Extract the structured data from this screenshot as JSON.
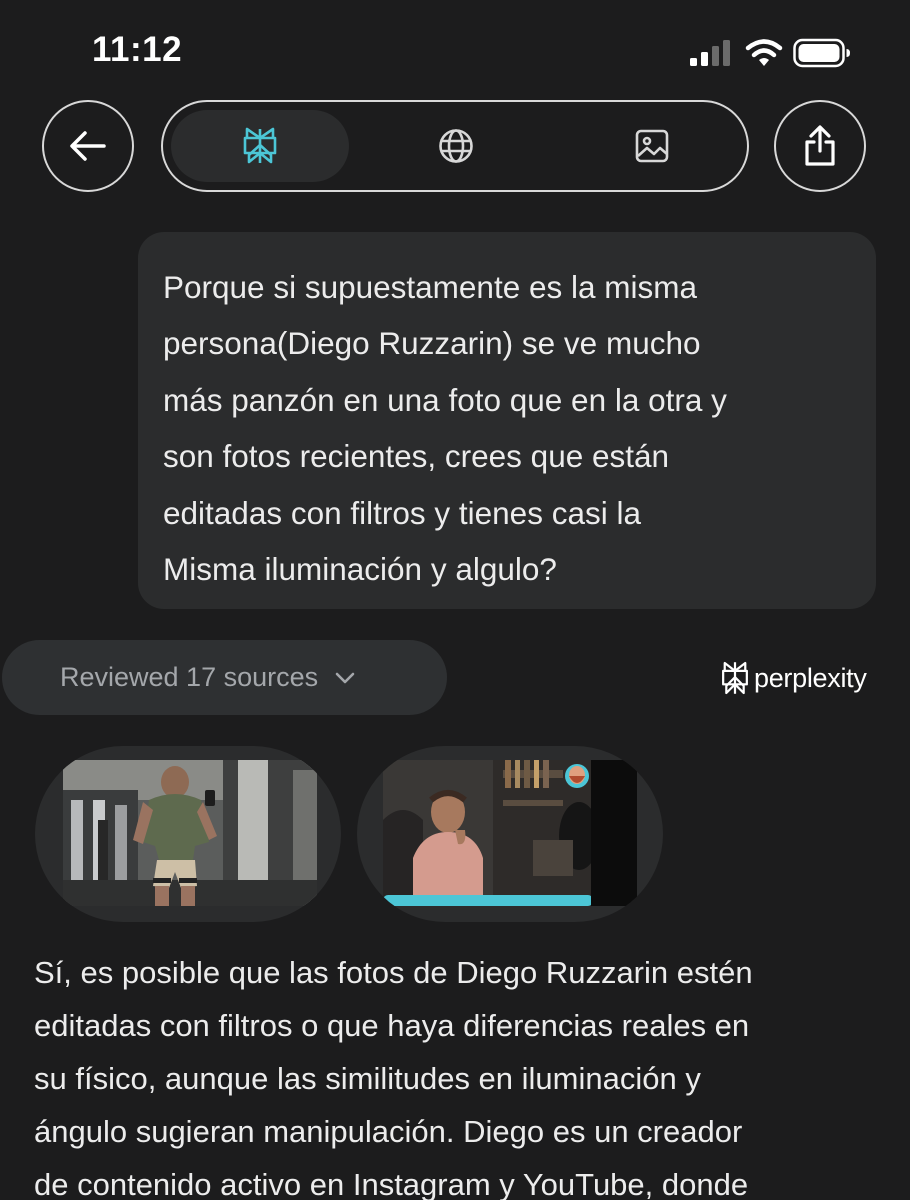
{
  "status_bar": {
    "time": "11:12"
  },
  "toolbar": {
    "back_icon": "arrow-left-icon",
    "share_icon": "share-icon",
    "tabs": [
      {
        "icon": "perplexity-logo-icon",
        "active": true
      },
      {
        "icon": "globe-icon",
        "active": false
      },
      {
        "icon": "image-icon",
        "active": false
      }
    ]
  },
  "question": {
    "lines": [
      "Porque si supuestamente es la misma",
      "persona(Diego Ruzzarin) se ve mucho",
      "más panzón en una foto que en la otra y",
      "son fotos recientes, crees que están",
      "editadas con filtros y tienes casi la",
      "Misma iluminación y algulo?"
    ]
  },
  "sources": {
    "label": "Reviewed 17 sources",
    "icon": "chevron-down-icon"
  },
  "brand": {
    "name": "perplexity"
  },
  "answer": {
    "lines": [
      "Sí, es posible que las fotos de Diego Ruzzarin estén",
      "editadas con filtros o que haya diferencias reales en",
      "su físico, aunque las similitudes en iluminación y",
      "ángulo sugieran manipulación. Diego es un creador",
      "de contenido activo en Instagram y YouTube, donde"
    ]
  },
  "colors": {
    "background": "#1c1c1d",
    "bubble": "#2b2c2d",
    "accent": "#4cc6d6"
  }
}
